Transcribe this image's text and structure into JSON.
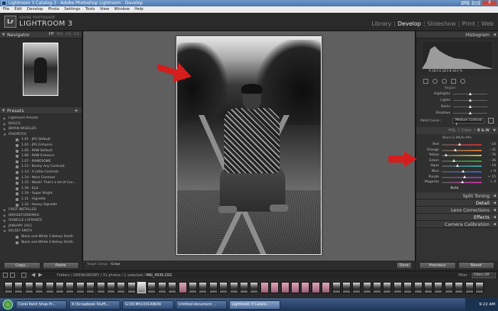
{
  "window": {
    "title": "Lightroom 3 Catalog-3 - Adobe Photoshop Lightroom - Develop",
    "controls": [
      "_",
      "□",
      "X"
    ]
  },
  "menu": [
    "File",
    "Edit",
    "Develop",
    "Photo",
    "Settings",
    "Tools",
    "View",
    "Window",
    "Help"
  ],
  "identity": {
    "badge": "Lr",
    "small": "ADOBE PHOTOSHOP",
    "big": "LIGHTROOM 3"
  },
  "modules": [
    "Library",
    "Develop",
    "Slideshow",
    "Print",
    "Web"
  ],
  "active_module": "Develop",
  "navigator": {
    "title": "Navigator",
    "zoom": [
      "FIT",
      "FILL",
      "1:1",
      "1:2"
    ]
  },
  "presets": {
    "title": "Presets",
    "items": [
      {
        "type": "folder",
        "label": "Lightroom Presets",
        "open": false
      },
      {
        "type": "folder",
        "label": "BASICS",
        "open": false
      },
      {
        "type": "folder",
        "label": "BRYAN WHEELER",
        "open": false
      },
      {
        "type": "folder",
        "label": "FAVORITES",
        "open": true
      },
      {
        "type": "item",
        "label": "1.01 - JPG Default"
      },
      {
        "type": "item",
        "label": "1.02 - JPG Enhance"
      },
      {
        "type": "item",
        "label": "1.05 - RAW Default"
      },
      {
        "type": "item",
        "label": "1.06 - RAW Enhance"
      },
      {
        "type": "item",
        "label": "1.07 - RAWESOME"
      },
      {
        "type": "item",
        "label": "1.12 - Barely Any Contrast"
      },
      {
        "type": "item",
        "label": "1.13 - A Little Contrast"
      },
      {
        "type": "item",
        "label": "1.14 - More Contrast"
      },
      {
        "type": "item",
        "label": "1.15 - Woah! That's a lot of Con..."
      },
      {
        "type": "item",
        "label": "1.16 - Epic"
      },
      {
        "type": "item",
        "label": "1.19 - Super Bright"
      },
      {
        "type": "item",
        "label": "1.31 - Vignette"
      },
      {
        "type": "item",
        "label": "1.32 - Heavy Vignette"
      },
      {
        "type": "folder",
        "label": "FIRST INSTALLED",
        "open": false
      },
      {
        "type": "folder",
        "label": "IBRAISEFORBOKEH",
        "open": false
      },
      {
        "type": "folder",
        "label": "ISABELLE LAFRANCE",
        "open": false
      },
      {
        "type": "folder",
        "label": "JANUARY 2011",
        "open": false
      },
      {
        "type": "folder",
        "label": "KELSEY SMITH",
        "open": true
      },
      {
        "type": "item",
        "label": "Black and White 1-Kelsey Smith"
      },
      {
        "type": "item",
        "label": "Black and White 2-Kelsey Smith"
      }
    ]
  },
  "left_buttons": {
    "copy": "Copy...",
    "paste": "Paste"
  },
  "toolbar": {
    "target_label": "Target Group :",
    "target_value": "Grays",
    "done": "Done"
  },
  "histogram": {
    "title": "Histogram",
    "readout": "R  18.5  G  18.5  B  18.5  %"
  },
  "tone": {
    "region": "Region",
    "rows": [
      {
        "label": "Highlights",
        "pos": 0.5
      },
      {
        "label": "Lights",
        "pos": 0.5
      },
      {
        "label": "Darks",
        "pos": 0.5
      },
      {
        "label": "Shadows",
        "pos": 0.5
      }
    ],
    "point_curve_label": "Point Curve :",
    "point_curve_value": "Medium Contrast ↕"
  },
  "hsl_tabs": [
    "HSL",
    "Color",
    "B & W"
  ],
  "active_tab": "B & W",
  "bw": {
    "title": "Black & White Mix",
    "rows": [
      {
        "label": "Red",
        "value": "- 10",
        "pos": 0.45,
        "color": "#c33"
      },
      {
        "label": "Orange",
        "value": "- 31",
        "pos": 0.35,
        "color": "#d73"
      },
      {
        "label": "Yellow",
        "value": "- 76",
        "pos": 0.12,
        "color": "#cc3"
      },
      {
        "label": "Green",
        "value": "- 36",
        "pos": 0.32,
        "color": "#3a3"
      },
      {
        "label": "Aqua",
        "value": "- 18",
        "pos": 0.41,
        "color": "#3aa"
      },
      {
        "label": "Blue",
        "value": "+ 9",
        "pos": 0.55,
        "color": "#36c"
      },
      {
        "label": "Purple",
        "value": "+ 15",
        "pos": 0.58,
        "color": "#93c"
      },
      {
        "label": "Magenta",
        "value": "+ 4",
        "pos": 0.52,
        "color": "#c3a"
      }
    ],
    "auto": "Auto"
  },
  "panels": [
    {
      "label": "Split Toning",
      "bright": false
    },
    {
      "label": "Detail",
      "bright": true
    },
    {
      "label": "Lens Corrections",
      "bright": false
    },
    {
      "label": "Effects",
      "bright": true
    },
    {
      "label": "Camera Calibration",
      "bright": false
    }
  ],
  "right_buttons": {
    "previous": "Previous",
    "reset": "Reset"
  },
  "filmbar": {
    "pages": [
      "1",
      "2"
    ],
    "path_prefix": "Folders / DREWLINDSEY / 31 photos / 1 selected /",
    "filename": "IMG_4335.CR2",
    "filter_label": "Filter :",
    "filter_value": "Filters Off"
  },
  "taskbar": {
    "items": [
      "Corel Paint Shop Pr...",
      "K:\\Scrapbook Stuff\\...",
      "G:\\DCIM\\103CANON",
      "Untitled document ...",
      "Lightroom 3 Catalo..."
    ],
    "active_index": 4,
    "clock": "9:22 AM"
  }
}
